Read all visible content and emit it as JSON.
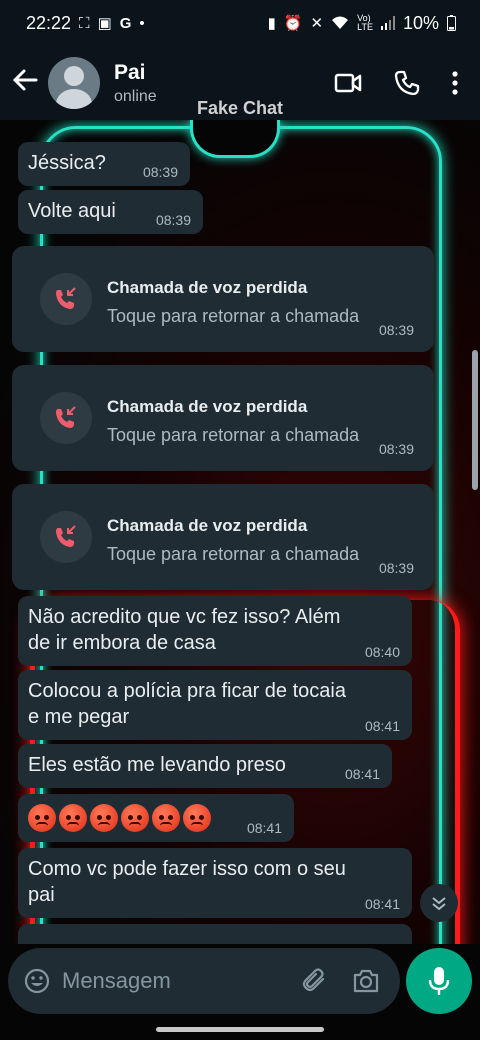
{
  "status_bar": {
    "time": "22:22",
    "battery": "10%",
    "left_icons": [
      "screenshot-icon",
      "image-icon",
      "g-icon",
      "dot"
    ],
    "right_icons": [
      "lock-icon",
      "alarm-icon",
      "mute-icon",
      "wifi-icon",
      "volte-icon",
      "signal-icon",
      "battery-icon"
    ]
  },
  "header": {
    "contact_name": "Pai",
    "contact_status": "online"
  },
  "watermark": "Fake Chat",
  "messages": [
    {
      "text": "Jéssica?",
      "time": "08:39"
    },
    {
      "text": "Volte aqui",
      "time": "08:39"
    },
    {
      "type": "missed_call",
      "title": "Chamada de voz perdida",
      "subtitle": "Toque para retornar a chamada",
      "time": "08:39"
    },
    {
      "type": "missed_call",
      "title": "Chamada de voz perdida",
      "subtitle": "Toque para retornar a chamada",
      "time": "08:39"
    },
    {
      "type": "missed_call",
      "title": "Chamada de voz perdida",
      "subtitle": "Toque para retornar a chamada",
      "time": "08:39"
    },
    {
      "text_line1": "Não acredito que vc fez isso? Além",
      "text_line2": "de ir embora de casa",
      "time": "08:40"
    },
    {
      "text_line1": "Colocou a polícia pra ficar de tocaia",
      "text_line2": "e me pegar",
      "time": "08:41"
    },
    {
      "text": "Eles estão me levando preso",
      "time": "08:41"
    },
    {
      "type": "emoji",
      "emojis": [
        "angry-face",
        "angry-face",
        "angry-face",
        "angry-face",
        "angry-face",
        "cursing-face"
      ],
      "time": "08:41"
    },
    {
      "text_line1": "Como vc pode fazer isso com o seu",
      "text_line2": "pai",
      "time": "08:41"
    }
  ],
  "composer": {
    "placeholder": "Mensagem"
  },
  "colors": {
    "bubble": "#202c33",
    "header": "#0b141a",
    "accent": "#00a884",
    "missed_call": "#f15c6d"
  }
}
